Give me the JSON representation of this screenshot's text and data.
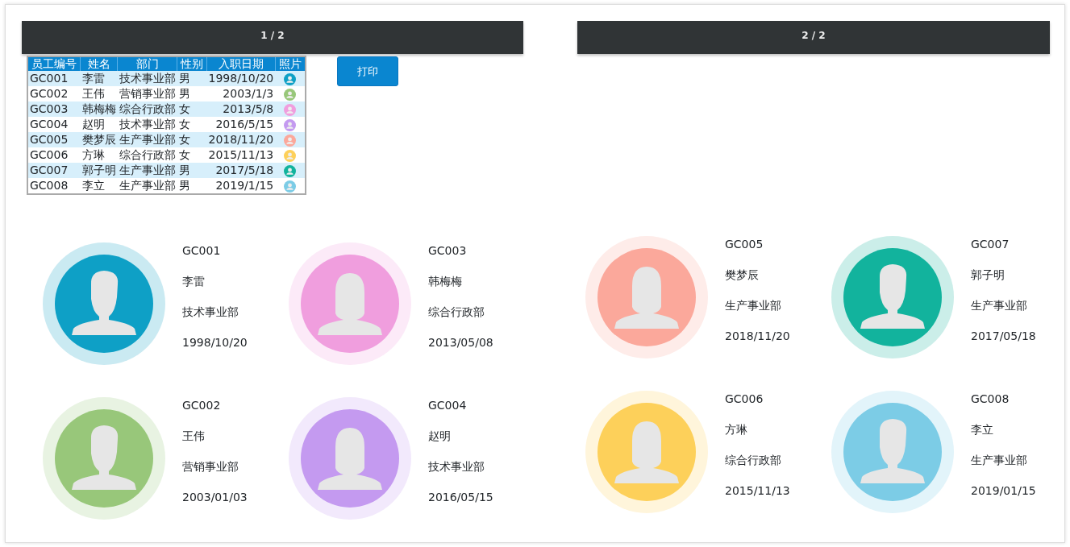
{
  "pages": [
    {
      "header": "1 / 2",
      "table": {
        "columns": [
          "员工编号",
          "姓名",
          "部门",
          "性别",
          "入职日期",
          "照片"
        ],
        "rows": [
          {
            "id": "GC001",
            "name": "李雷",
            "dept": "技术事业部",
            "gender": "男",
            "date": "1998/10/20",
            "color": "#0ea0c6"
          },
          {
            "id": "GC002",
            "name": "王伟",
            "dept": "营销事业部",
            "gender": "男",
            "date": "2003/1/3",
            "color": "#98c77a"
          },
          {
            "id": "GC003",
            "name": "韩梅梅",
            "dept": "综合行政部",
            "gender": "女",
            "date": "2013/5/8",
            "color": "#f09ede"
          },
          {
            "id": "GC004",
            "name": "赵明",
            "dept": "技术事业部",
            "gender": "女",
            "date": "2016/5/15",
            "color": "#c49af0"
          },
          {
            "id": "GC005",
            "name": "樊梦辰",
            "dept": "生产事业部",
            "gender": "女",
            "date": "2018/11/20",
            "color": "#fba89b"
          },
          {
            "id": "GC006",
            "name": "方琳",
            "dept": "综合行政部",
            "gender": "女",
            "date": "2015/11/13",
            "color": "#fdd05a"
          },
          {
            "id": "GC007",
            "name": "郭子明",
            "dept": "生产事业部",
            "gender": "男",
            "date": "2017/5/18",
            "color": "#12b39d"
          },
          {
            "id": "GC008",
            "name": "李立",
            "dept": "生产事业部",
            "gender": "男",
            "date": "2019/1/15",
            "color": "#7ccce6"
          }
        ]
      },
      "print_button": "打印",
      "cards": [
        {
          "kind": "male",
          "color": "#0ea0c6",
          "id": "GC001",
          "name": "李雷",
          "dept": "技术事业部",
          "date": "1998/10/20"
        },
        {
          "kind": "female",
          "color": "#f09ede",
          "id": "GC003",
          "name": "韩梅梅",
          "dept": "综合行政部",
          "date": "2013/05/08"
        },
        {
          "kind": "male",
          "color": "#98c77a",
          "id": "GC002",
          "name": "王伟",
          "dept": "营销事业部",
          "date": "2003/01/03"
        },
        {
          "kind": "female",
          "color": "#c49af0",
          "id": "GC004",
          "name": "赵明",
          "dept": "技术事业部",
          "date": "2016/05/15"
        }
      ]
    },
    {
      "header": "2 / 2",
      "cards": [
        {
          "kind": "female",
          "color": "#fba89b",
          "id": "GC005",
          "name": "樊梦辰",
          "dept": "生产事业部",
          "date": "2018/11/20"
        },
        {
          "kind": "male",
          "color": "#12b39d",
          "id": "GC007",
          "name": "郭子明",
          "dept": "生产事业部",
          "date": "2017/05/18"
        },
        {
          "kind": "female",
          "color": "#fdd05a",
          "id": "GC006",
          "name": "方琳",
          "dept": "综合行政部",
          "date": "2015/11/13"
        },
        {
          "kind": "male",
          "color": "#7ccce6",
          "id": "GC008",
          "name": "李立",
          "dept": "生产事业部",
          "date": "2019/01/15"
        }
      ]
    }
  ]
}
